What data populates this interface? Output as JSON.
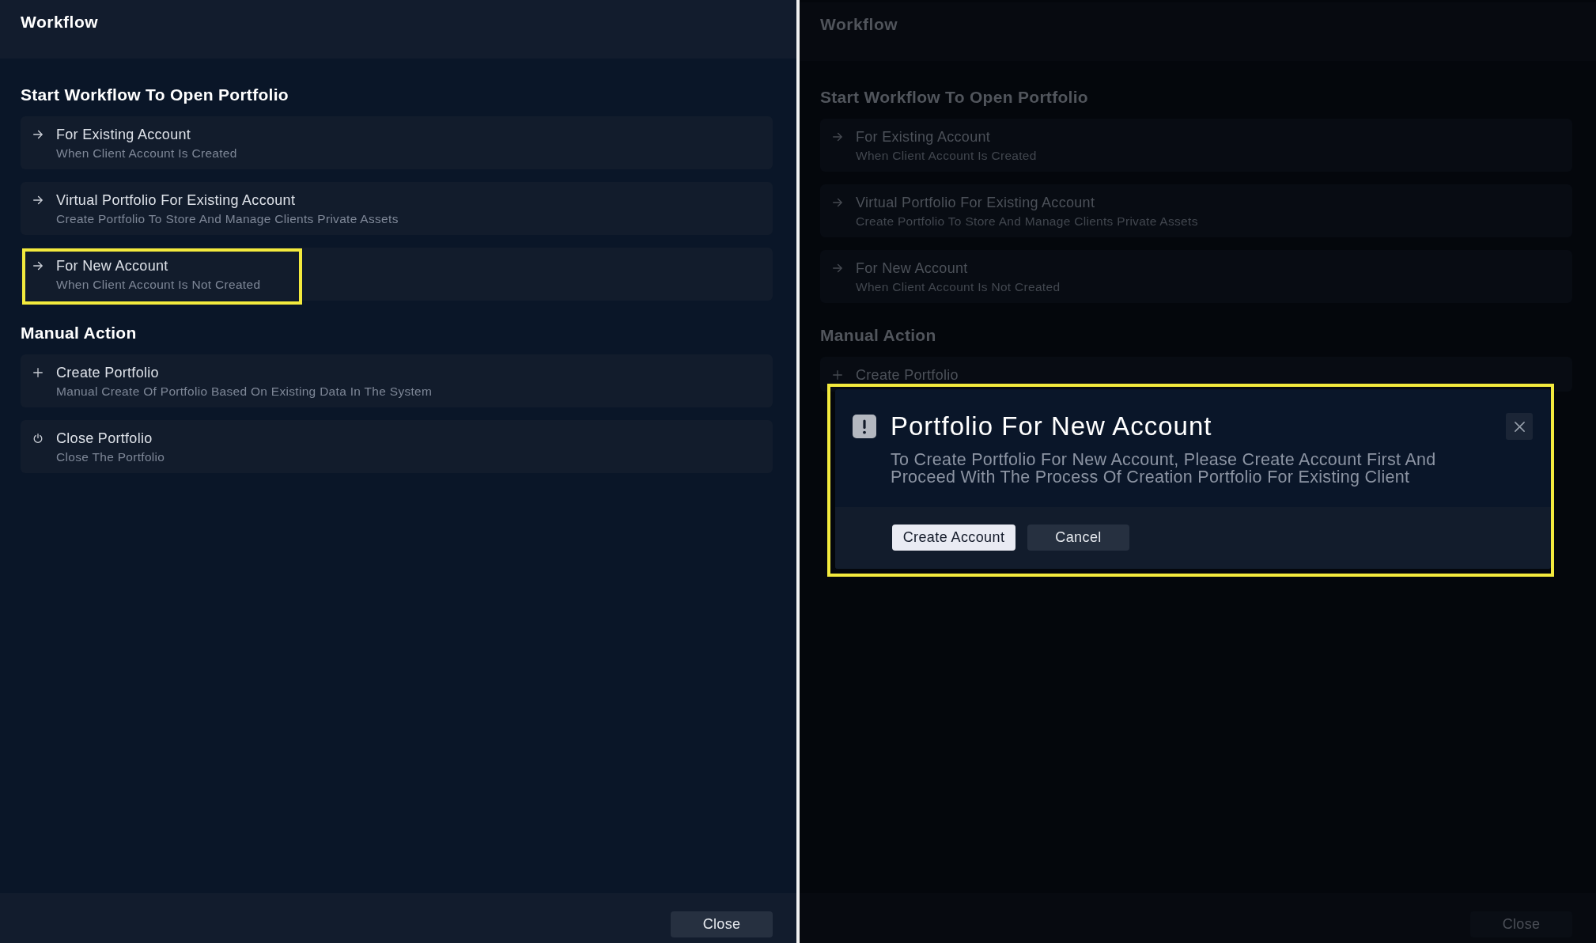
{
  "screens": [
    {
      "dimmed": false,
      "window": {
        "title": "Workflow"
      },
      "sections": [
        {
          "heading": "Start Workflow To Open Portfolio",
          "items": [
            {
              "kind": "start",
              "title": "For Existing Account",
              "subtitle": "When Client Account Is Created",
              "highlighted": false
            },
            {
              "kind": "start",
              "title": "Virtual Portfolio For Existing Account",
              "subtitle": "Create Portfolio To Store And Manage Clients Private Assets",
              "highlighted": false
            },
            {
              "kind": "start",
              "title": "For New Account",
              "subtitle": "When Client Account Is Not Created",
              "highlighted": true
            }
          ]
        },
        {
          "heading": "Manual Action",
          "items": [
            {
              "kind": "create",
              "title": "Create Portfolio",
              "subtitle": "Manual Create Of Portfolio Based On Existing Data In The System",
              "highlighted": false
            },
            {
              "kind": "close",
              "title": "Close Portfolio",
              "subtitle": "Close The Portfolio",
              "highlighted": false
            }
          ]
        }
      ],
      "footer": {
        "button": "Close"
      }
    },
    {
      "dimmed": true,
      "window": {
        "title": "Workflow"
      },
      "sections": [
        {
          "heading": "Start Workflow To Open Portfolio",
          "items": [
            {
              "kind": "start",
              "title": "For Existing Account",
              "subtitle": "When Client Account Is Created",
              "highlighted": false
            },
            {
              "kind": "start",
              "title": "Virtual Portfolio For Existing Account",
              "subtitle": "Create Portfolio To Store And Manage Clients Private Assets",
              "highlighted": false
            },
            {
              "kind": "start",
              "title": "For New Account",
              "subtitle": "When Client Account Is Not Created",
              "highlighted": false
            }
          ]
        },
        {
          "heading": "Manual Action",
          "items": [
            {
              "kind": "create",
              "title": "Create Portfolio",
              "highlighted": false
            }
          ]
        }
      ],
      "footer": {
        "button": "Close"
      },
      "dialog": {
        "highlighted": true,
        "title": "Portfolio For New Account",
        "message": "To Create Portfolio For New Account, Please Create Account First And Proceed With The Process Of Creation Portfolio For Existing Client",
        "buttons": [
          {
            "kind": "primary",
            "label": "Create Account"
          },
          {
            "kind": "secondary",
            "label": "Cancel"
          }
        ]
      }
    }
  ]
}
